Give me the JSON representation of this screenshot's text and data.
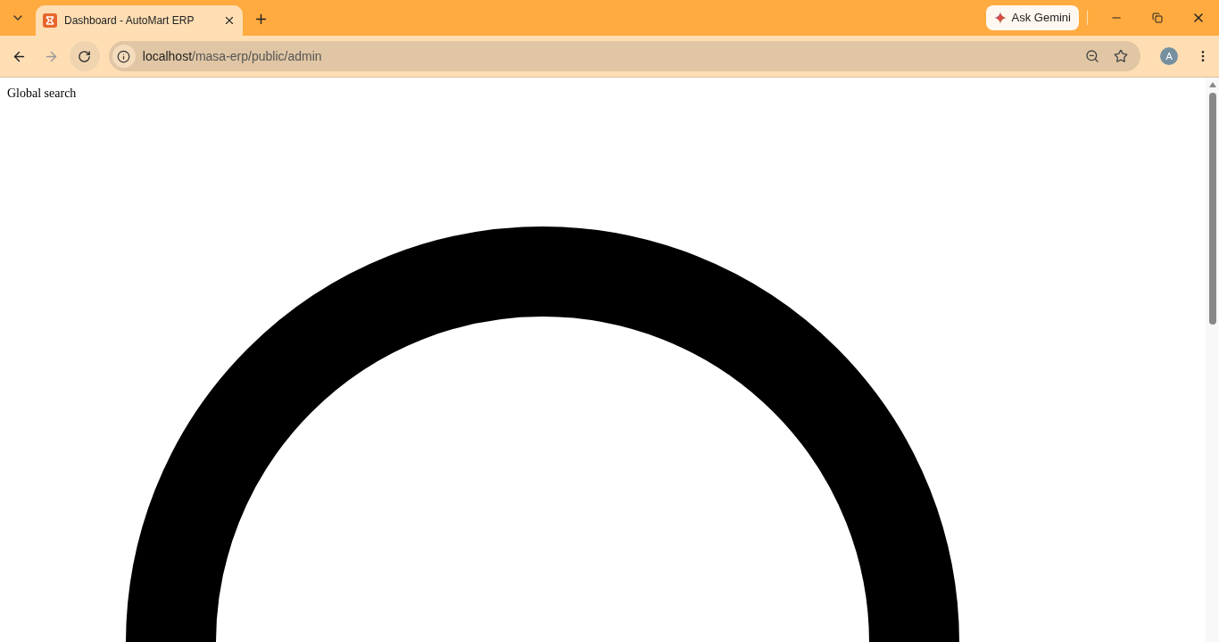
{
  "tabs": [
    {
      "title": "Dashboard - AutoMart ERP",
      "selected": true
    }
  ],
  "gemini_button": {
    "label": "Ask Gemini"
  },
  "address_bar": {
    "host": "localhost",
    "path": "/masa-erp/public/admin"
  },
  "profile": {
    "initial": "A"
  },
  "page": {
    "text": "Global search"
  }
}
